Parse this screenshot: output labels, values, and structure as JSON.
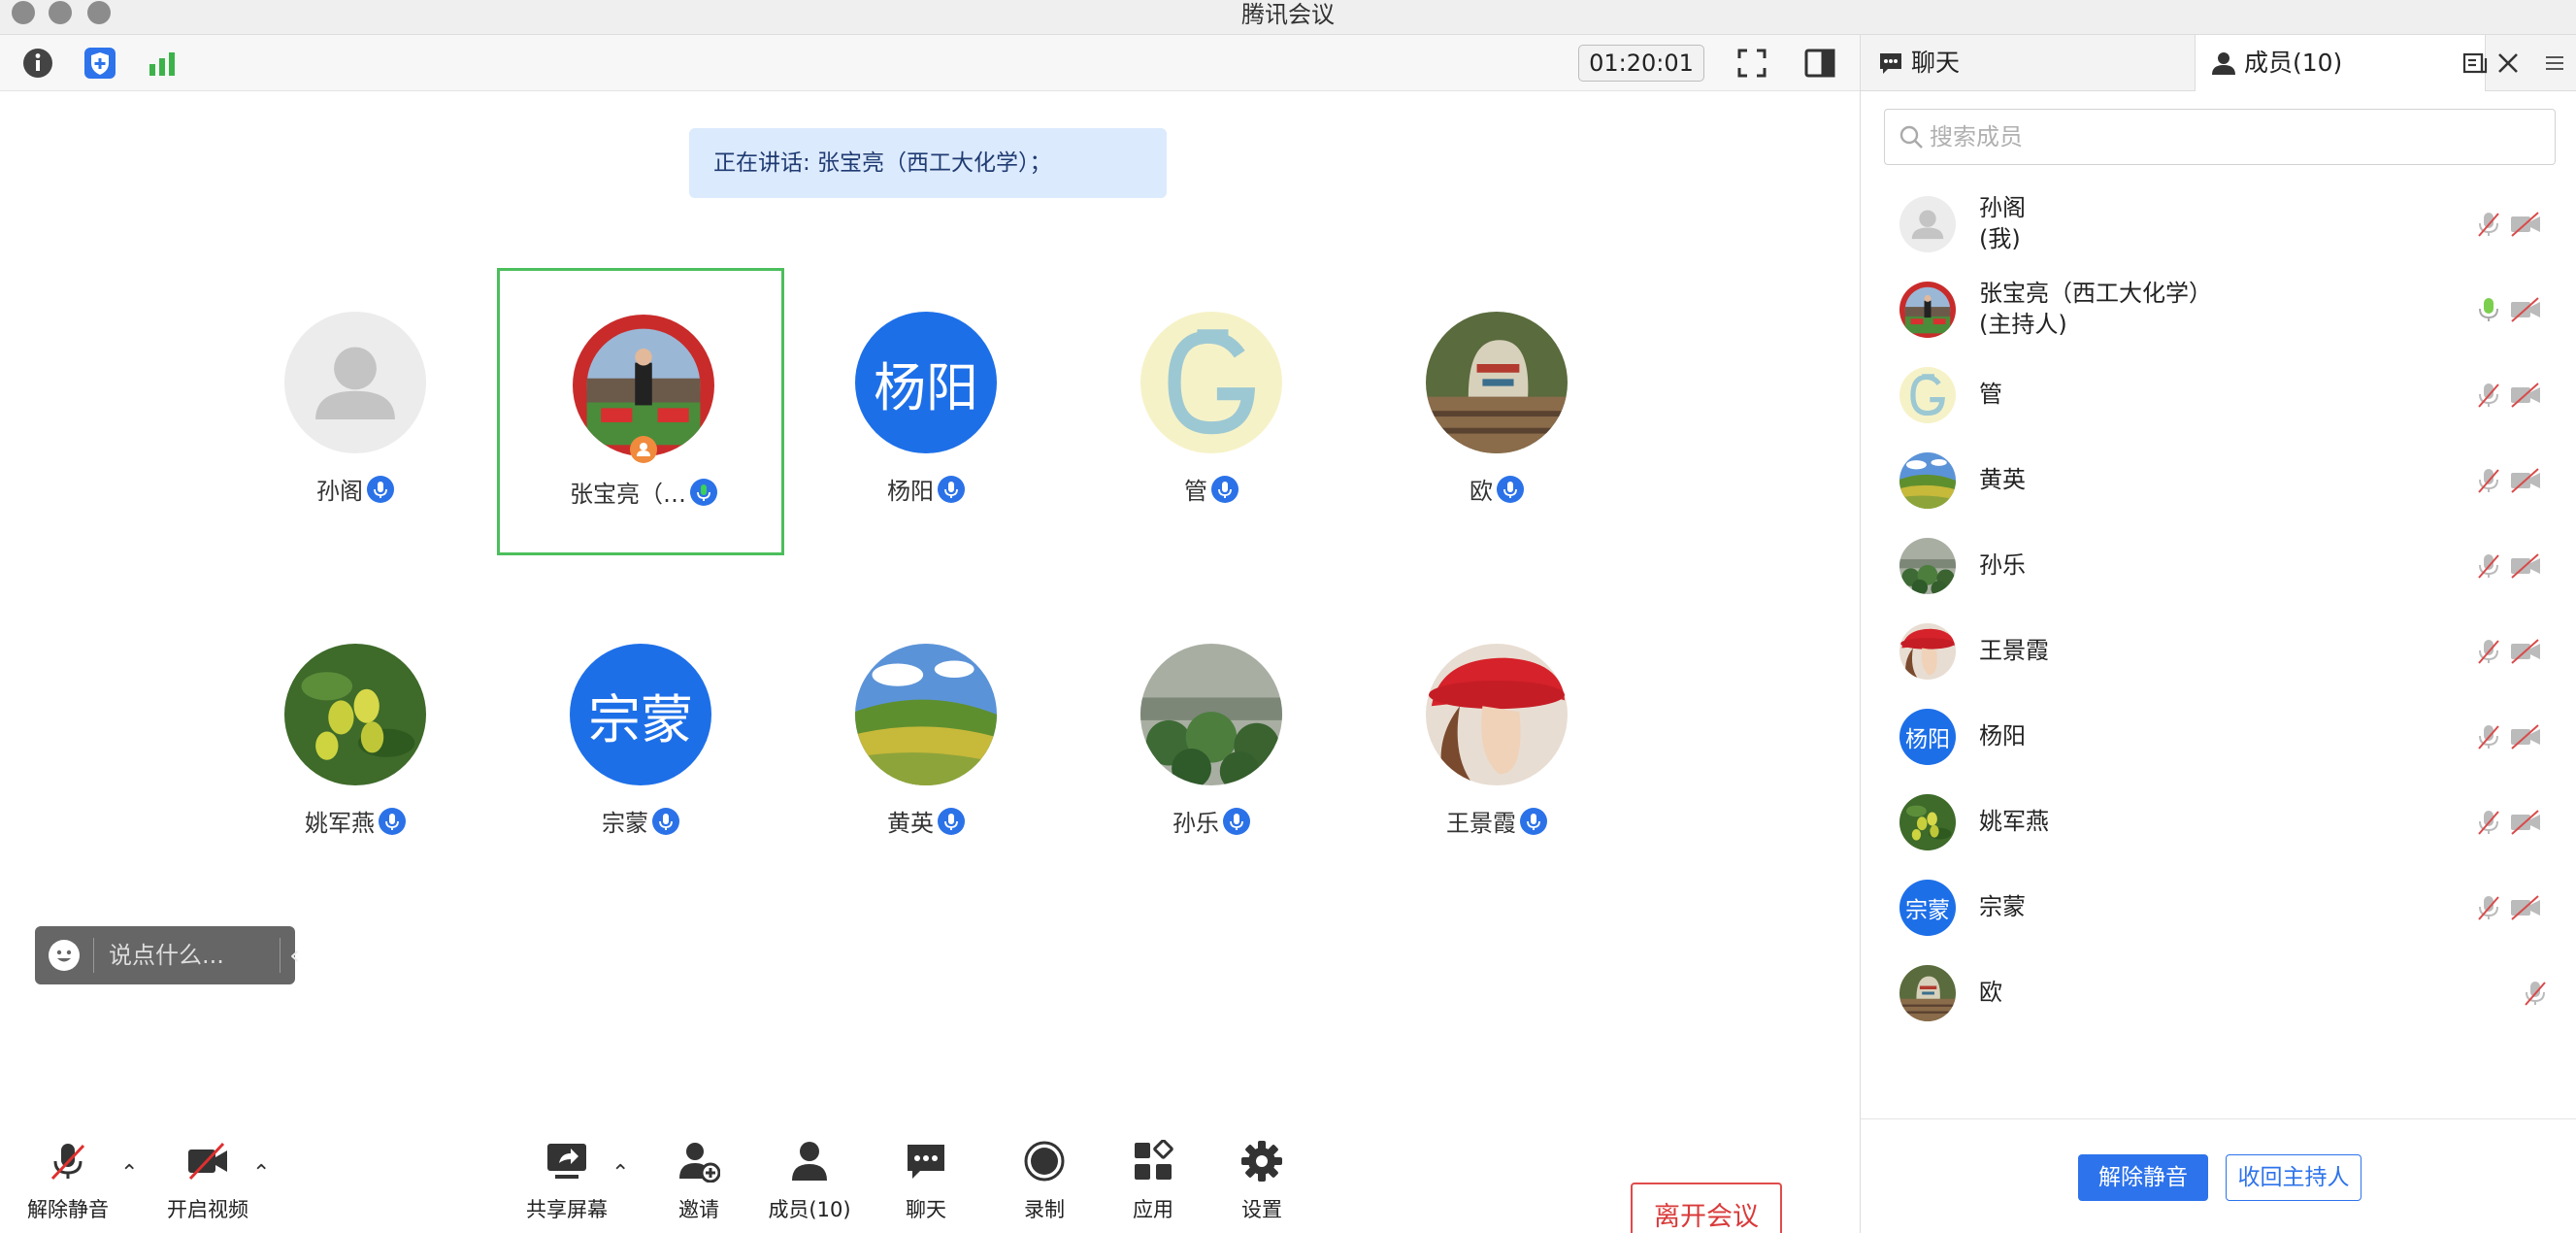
{
  "window": {
    "title": "腾讯会议"
  },
  "toolbar": {
    "timer": "01:20:01"
  },
  "speaking": {
    "text": "正在讲话: 张宝亮（西工大化学）；"
  },
  "participants": [
    {
      "name": "孙阁",
      "type": "default"
    },
    {
      "name": "张宝亮（…",
      "type": "photo-red"
    },
    {
      "name": "杨阳",
      "type": "text",
      "initials": "杨阳"
    },
    {
      "name": "管",
      "type": "g-logo"
    },
    {
      "name": "欧",
      "type": "photo-mask"
    },
    {
      "name": "姚军燕",
      "type": "photo-fruit"
    },
    {
      "name": "宗蒙",
      "type": "text",
      "initials": "宗蒙"
    },
    {
      "name": "黄英",
      "type": "photo-field"
    },
    {
      "name": "孙乐",
      "type": "photo-lotus"
    },
    {
      "name": "王景霞",
      "type": "photo-hat"
    }
  ],
  "chat_input": {
    "placeholder": "说点什么..."
  },
  "bottom_bar": {
    "unmute": "解除静音",
    "video": "开启视频",
    "share": "共享屏幕",
    "invite": "邀请",
    "members": "成员(10)",
    "chat": "聊天",
    "record": "录制",
    "apps": "应用",
    "settings": "设置",
    "leave": "离开会议"
  },
  "panel": {
    "tab_chat": "聊天",
    "tab_members": "成员(10)",
    "search_placeholder": "搜索成员",
    "members": [
      {
        "name": "孙阁",
        "sub": "(我)",
        "avatar": "default"
      },
      {
        "name": "张宝亮（西工大化学）",
        "sub": "(主持人)",
        "avatar": "photo-red"
      },
      {
        "name": "管",
        "sub": "",
        "avatar": "g-logo"
      },
      {
        "name": "黄英",
        "sub": "",
        "avatar": "photo-field"
      },
      {
        "name": "孙乐",
        "sub": "",
        "avatar": "photo-lotus"
      },
      {
        "name": "王景霞",
        "sub": "",
        "avatar": "photo-hat"
      },
      {
        "name": "杨阳",
        "sub": "",
        "avatar": "text",
        "initials": "杨阳"
      },
      {
        "name": "姚军燕",
        "sub": "",
        "avatar": "photo-fruit"
      },
      {
        "name": "宗蒙",
        "sub": "",
        "avatar": "text",
        "initials": "宗蒙"
      },
      {
        "name": "欧",
        "sub": "",
        "avatar": "photo-mask"
      }
    ],
    "unmute_all": "解除静音",
    "reclaim_host": "收回主持人"
  },
  "colors": {
    "accent": "#2d73eb",
    "speaking_green": "#4bbf5c",
    "leave_red": "#e04b4b"
  }
}
